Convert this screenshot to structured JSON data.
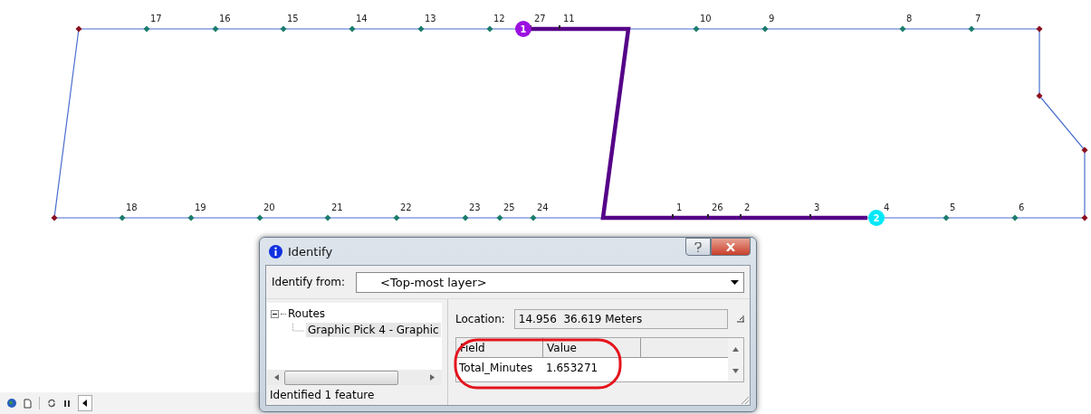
{
  "map": {
    "top_nodes": [
      {
        "label": "17",
        "on_route": false
      },
      {
        "label": "16",
        "on_route": false
      },
      {
        "label": "15",
        "on_route": false
      },
      {
        "label": "14",
        "on_route": false
      },
      {
        "label": "13",
        "on_route": false
      },
      {
        "label": "12",
        "on_route": false
      },
      {
        "label": "27",
        "on_route": true
      },
      {
        "label": "11",
        "on_route": true
      },
      {
        "label": "10",
        "on_route": false
      },
      {
        "label": "9",
        "on_route": false
      },
      {
        "label": "8",
        "on_route": false
      },
      {
        "label": "7",
        "on_route": false
      }
    ],
    "bottom_nodes": [
      {
        "label": "18",
        "on_route": false
      },
      {
        "label": "19",
        "on_route": false
      },
      {
        "label": "20",
        "on_route": false
      },
      {
        "label": "21",
        "on_route": false
      },
      {
        "label": "22",
        "on_route": false
      },
      {
        "label": "23",
        "on_route": false
      },
      {
        "label": "25",
        "on_route": false
      },
      {
        "label": "24",
        "on_route": false
      },
      {
        "label": "1",
        "on_route": true
      },
      {
        "label": "26",
        "on_route": true
      },
      {
        "label": "2",
        "on_route": true
      },
      {
        "label": "3",
        "on_route": true
      },
      {
        "label": "4",
        "on_route": false
      },
      {
        "label": "5",
        "on_route": false
      },
      {
        "label": "6",
        "on_route": false
      }
    ],
    "stops": [
      {
        "label": "1",
        "color": "#9b10e0"
      },
      {
        "label": "2",
        "color": "#00e8f8"
      }
    ]
  },
  "identify": {
    "title": "Identify",
    "from_label": "Identify from:",
    "from_value": "<Top-most layer>",
    "tree": [
      {
        "label": "Routes",
        "expanded": true,
        "children": [
          {
            "label": "Graphic Pick 4 - Graphic",
            "selected": true
          }
        ]
      }
    ],
    "location_label": "Location:",
    "location_value": "14.956  36.619 Meters",
    "columns": [
      "Field",
      "Value"
    ],
    "rows": [
      {
        "field": "Total_Minutes",
        "value": "1.653271"
      }
    ],
    "status": "Identified 1 feature"
  }
}
